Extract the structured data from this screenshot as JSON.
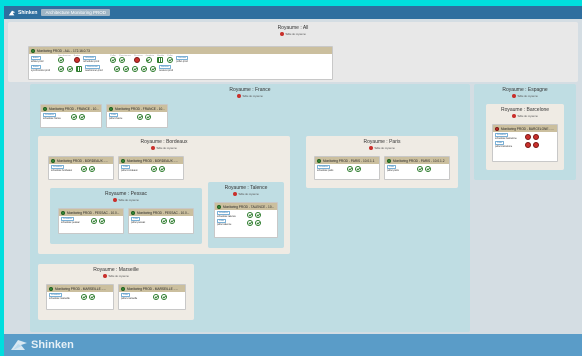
{
  "topbar": {
    "brand": "Shinken",
    "tab": "Architecture Monitoring PROD"
  },
  "footer": {
    "brand": "Shinken"
  },
  "realms": {
    "all": {
      "title": "Royaume : All",
      "sub": "Table de royaume",
      "card": {
        "header": "Monitoring PROD - ALL - 172.16.0.73",
        "row1_labels": [
          "Arbiter",
          "Synchronizer",
          "Broker",
          "Scheduler",
          "Poller",
          "Reactionner",
          "Receiver",
          "Graphite",
          "Module",
          "Poller",
          "Receiver"
        ],
        "row1_text": [
          "arbiter-prod",
          "broker-prod",
          "scheduler-prod",
          "poller-prod"
        ],
        "row2_text": [
          "synchronizer-prod",
          "reactionner-prod",
          "receiver-prod"
        ]
      }
    },
    "france": {
      "title": "Royaume : France",
      "sub": "Table de royaume",
      "cards": [
        {
          "header": "Monitoring PROD - FRANCE - 10...",
          "a": "scheduler-france",
          "b": "poller-france"
        },
        {
          "header": "Monitoring PROD - FRANCE - 10...",
          "a": "scheduler-france",
          "b": "poller-france"
        }
      ]
    },
    "bordeaux": {
      "title": "Royaume : Bordeaux",
      "sub": "Table de royaume",
      "cards": [
        {
          "header": "Monitoring PROD - BORDEAUX - ...",
          "a": "scheduler-bordeaux",
          "b": "poller-bordeaux"
        },
        {
          "header": "Monitoring PROD - BORDEAUX - ...",
          "a": "scheduler-bordeaux",
          "b": "poller-bordeaux"
        }
      ]
    },
    "pessac": {
      "title": "Royaume : Pessac",
      "sub": "Table de royaume",
      "cards": [
        {
          "header": "Monitoring PROD - PESSAC - 10.0...",
          "a": "scheduler-pessac",
          "b": "poller-pessac"
        },
        {
          "header": "Monitoring PROD - PESSAC - 10.0...",
          "a": "scheduler-pessac",
          "b": "poller-pessac"
        }
      ]
    },
    "talence": {
      "title": "Royaume : Talence",
      "sub": "Table de royaume",
      "card": {
        "header": "Monitoring PROD - TALENCE - 10...",
        "a": "scheduler-talence",
        "b": "poller-talence"
      }
    },
    "paris": {
      "title": "Royaume : Paris",
      "sub": "Table de royaume",
      "cards": [
        {
          "header": "Monitoring PROD - PARIS - 10.0.1.1",
          "a": "scheduler-paris",
          "b": "poller-paris"
        },
        {
          "header": "Monitoring PROD - PARIS - 10.0.1.2",
          "a": "scheduler-paris",
          "b": "poller-paris"
        }
      ]
    },
    "marseille": {
      "title": "Royaume : Marseille",
      "sub": "Table de royaume",
      "cards": [
        {
          "header": "Monitoring PROD - MARSEILLE - ...",
          "a": "scheduler-marseille",
          "b": "poller-marseille"
        },
        {
          "header": "Monitoring PROD - MARSEILLE - ...",
          "a": "scheduler-marseille",
          "b": "poller-marseille"
        }
      ]
    },
    "espagne": {
      "title": "Royaume : Espagne",
      "sub": "Table de royaume"
    },
    "barcelone": {
      "title": "Royaume : Barcelone",
      "sub": "Table de royaume",
      "card": {
        "header": "Monitoring PROD - BARCELONE - ...",
        "a": "scheduler-barcelone",
        "b": "poller-barcelone"
      }
    }
  },
  "labels": {
    "scheduler": "Scheduler",
    "poller": "Poller",
    "broker": "Broker",
    "receiver": "Receiver",
    "reactionner": "Reactionner"
  },
  "colors": {
    "page_bg": "#00dede",
    "topbar": "#2f6f9f",
    "footer": "#5a9cc8",
    "realm_outer": "#bfdde3",
    "realm_inner": "#efebe4",
    "card_header": "#cbbf9e",
    "ok": "#2f7d2f",
    "critical": "#c9302c"
  }
}
